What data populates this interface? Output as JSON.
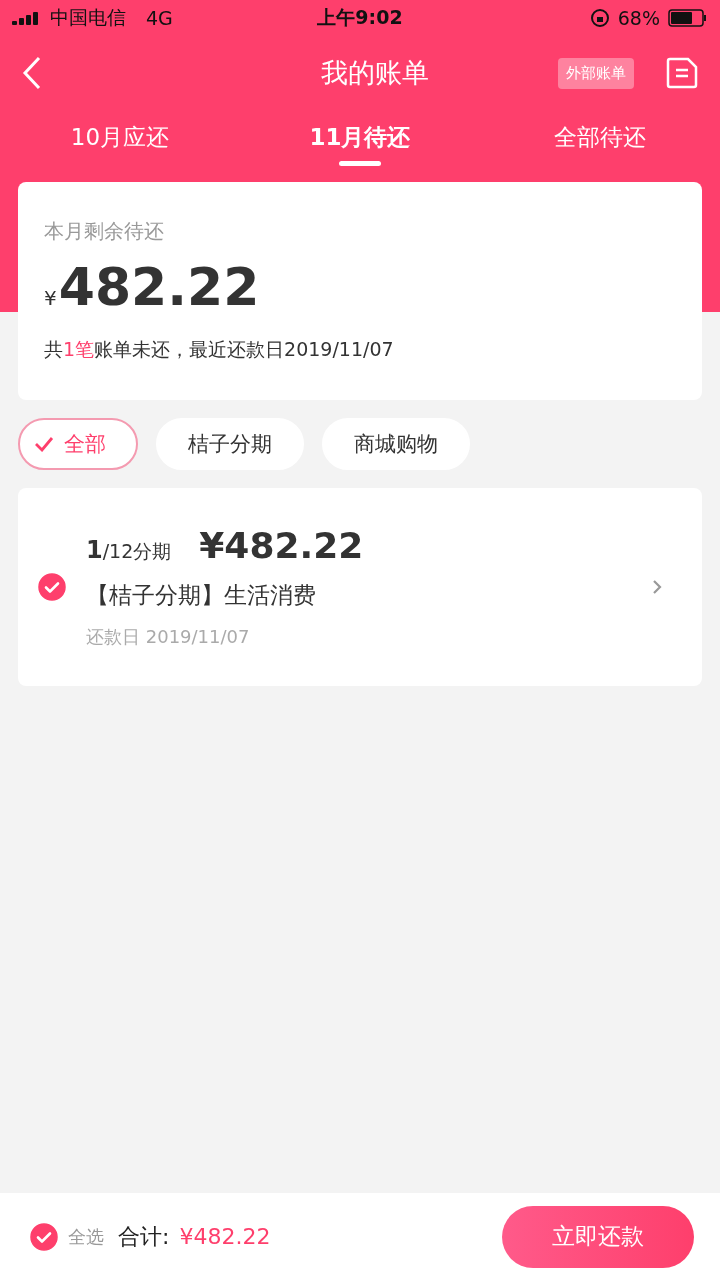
{
  "status_bar": {
    "carrier": "中国电信",
    "network": "4G",
    "time": "上午9:02",
    "battery": "68%"
  },
  "nav": {
    "title": "我的账单",
    "external_button": "外部账单"
  },
  "tabs": [
    {
      "label": "10月应还",
      "selected": false
    },
    {
      "label": "11月待还",
      "selected": true
    },
    {
      "label": "全部待还",
      "selected": false
    }
  ],
  "summary": {
    "label": "本月剩余待还",
    "currency": "¥",
    "amount": "482.22",
    "note": "共**1笔**账单未还，最近还款日2019/11/07"
  },
  "filters": [
    {
      "label": "全部",
      "selected": true
    },
    {
      "label": "桔子分期",
      "selected": false
    },
    {
      "label": "商城购物",
      "selected": false
    }
  ],
  "bills": [
    {
      "installment": "**1**/12分期",
      "amount": "¥482.22",
      "title": "【桔子分期】生活消费",
      "due": "还款日 2019/11/07",
      "checked": true
    }
  ],
  "footer": {
    "select_all": {
      "label": "全选",
      "checked": true
    },
    "total_label": "合计:",
    "total": "¥482.22",
    "pay_button": "立即还款"
  }
}
